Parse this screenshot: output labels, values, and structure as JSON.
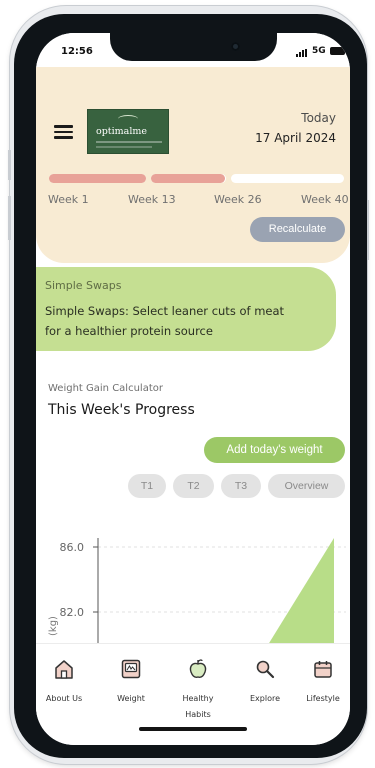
{
  "status_bar": {
    "time": "12:56",
    "network": "5G"
  },
  "header": {
    "logo_text": "optimalme",
    "date_label": "Today",
    "date_value": "17 April 2024",
    "progress": {
      "weeks_completed": 22,
      "total_weeks": 40,
      "fraction": 0.55
    },
    "weeks": [
      "Week 1",
      "Week 13",
      "Week 26",
      "Week 40"
    ],
    "recalculate_label": "Recalculate"
  },
  "simple_swaps": {
    "kicker": "Simple Swaps",
    "text": "Simple Swaps: Select leaner cuts of meat for a healthier protein source"
  },
  "calculator": {
    "kicker": "Weight Gain Calculator",
    "title": "This Week's Progress",
    "add_weight_label": "Add today's weight",
    "tabs": [
      "T1",
      "T2",
      "T3",
      "Overview"
    ]
  },
  "chart_data": {
    "type": "area",
    "ylabel": "(kg)",
    "y_ticks": [
      86.0,
      82.0
    ],
    "y_tick_labels": [
      "86.0",
      "82.0"
    ],
    "grid": true
  },
  "nav": {
    "items": [
      {
        "label": "About Us",
        "icon": "home-icon"
      },
      {
        "label": "Weight",
        "icon": "scale-icon"
      },
      {
        "label": "Healthy Habits",
        "icon": "apple-icon"
      },
      {
        "label": "Explore",
        "icon": "search-icon"
      },
      {
        "label": "Lifestyle",
        "icon": "calendar-icon"
      }
    ]
  },
  "colors": {
    "header_bg": "#f8ebd3",
    "progress_fill": "#e8a298",
    "swaps_bg": "#c5df92",
    "add_button": "#9cc866",
    "recalc_button": "#9aa3b2",
    "chart_area": "#b8dd88",
    "logo_bg": "#38623f"
  }
}
